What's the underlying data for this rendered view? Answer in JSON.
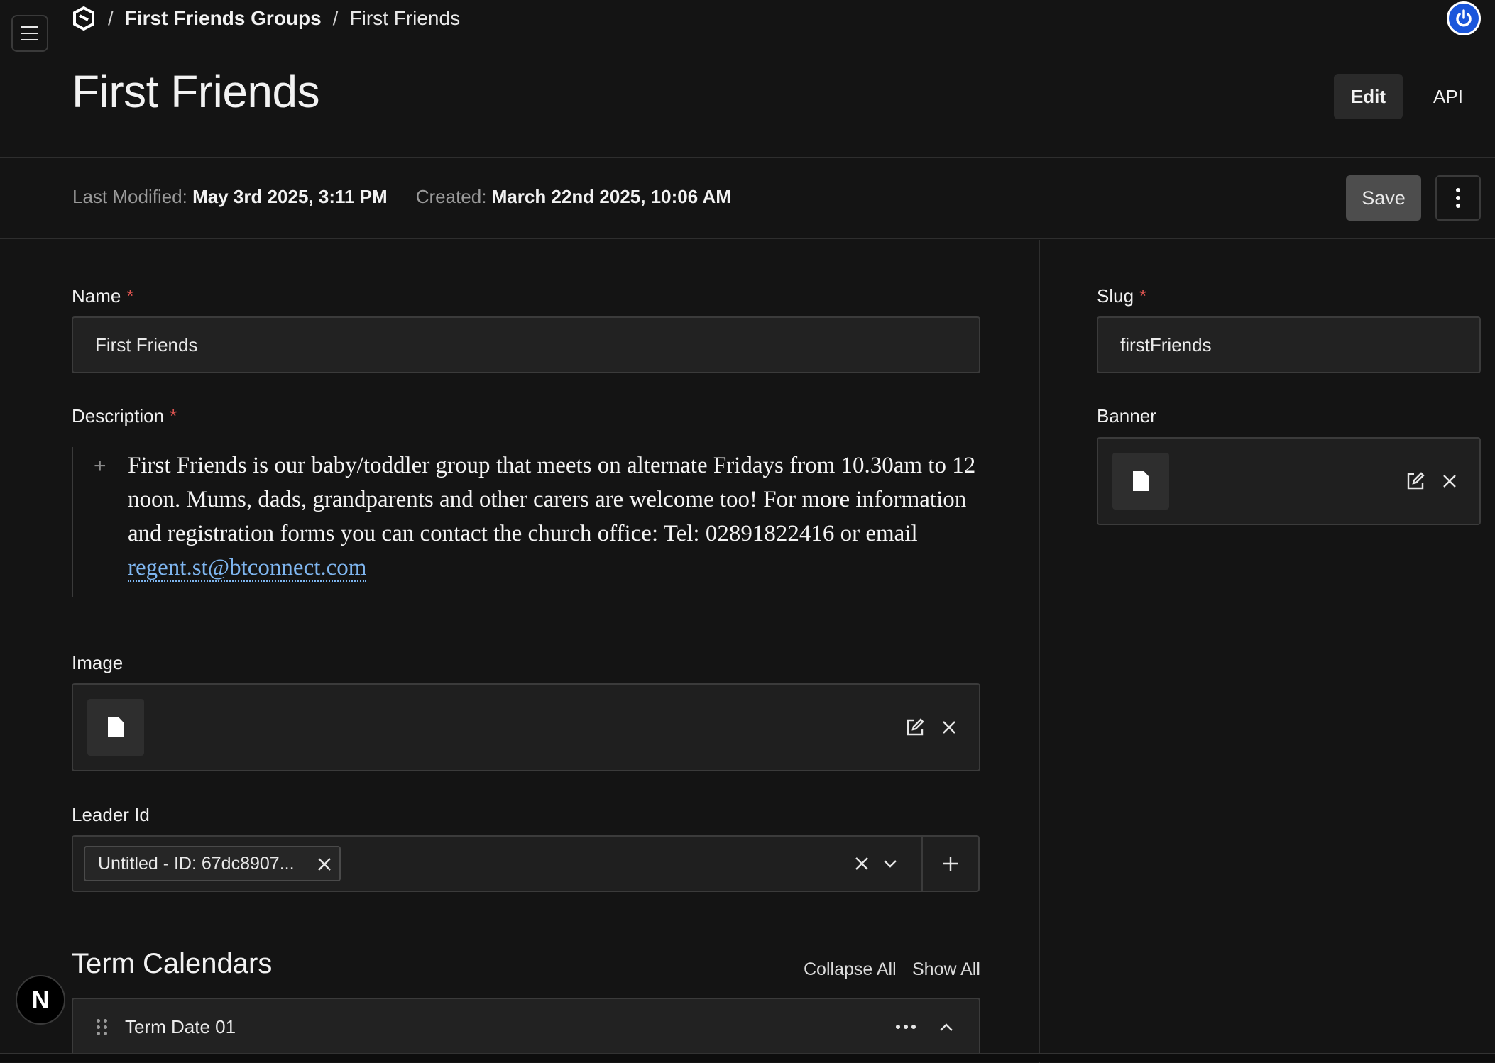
{
  "header": {
    "breadcrumb": [
      "First Friends Groups",
      "First Friends"
    ],
    "separator": "/"
  },
  "page": {
    "title": "First Friends",
    "tabs": {
      "edit": "Edit",
      "api": "API"
    }
  },
  "meta": {
    "last_modified_label": "Last Modified:",
    "last_modified_value": "May 3rd 2025, 3:11 PM",
    "created_label": "Created:",
    "created_value": "March 22nd 2025, 10:06 AM",
    "save_label": "Save"
  },
  "fields": {
    "name": {
      "label": "Name",
      "required_mark": "*",
      "value": "First Friends"
    },
    "description": {
      "label": "Description",
      "required_mark": "*",
      "text": "First Friends is our baby/toddler group that meets on alternate Fridays from 10.30am to 12 noon.  Mums, dads, grandparents and other carers are welcome too! For more information and registration forms you can contact the church office: Tel: 02891822416 or email",
      "link": "regent.st@btconnect.com"
    },
    "image": {
      "label": "Image"
    },
    "leader_id": {
      "label": "Leader Id",
      "selected": "Untitled - ID: 67dc8907..."
    },
    "slug": {
      "label": "Slug",
      "required_mark": "*",
      "value": "firstFriends"
    },
    "banner": {
      "label": "Banner"
    }
  },
  "term_calendars": {
    "title": "Term Calendars",
    "collapse_all": "Collapse All",
    "show_all": "Show All",
    "rows": [
      {
        "label": "Term Date 01"
      }
    ]
  },
  "badge": {
    "letter": "N"
  },
  "colors": {
    "background": "#141414",
    "accent": "#1a56db",
    "link": "#7fb6f0",
    "required": "#d9534f"
  },
  "icons": [
    "menu-icon",
    "logo-icon",
    "power-icon",
    "more-vertical-icon",
    "plus-icon",
    "file-icon",
    "edit-icon",
    "close-icon",
    "chevron-down-icon",
    "chevron-up-icon",
    "drag-handle-icon",
    "more-horizontal-icon"
  ]
}
